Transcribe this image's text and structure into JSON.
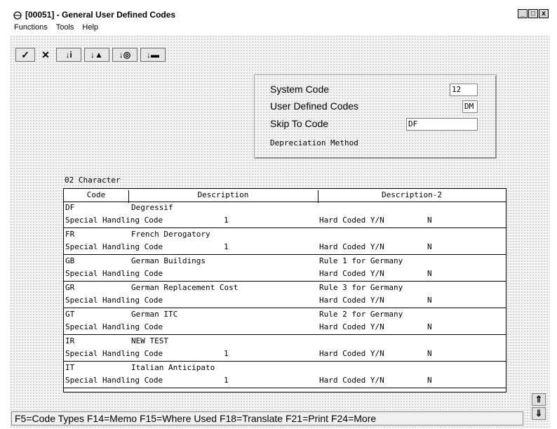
{
  "window": {
    "title": "[00051] - General User Defined Codes",
    "minimize": "_",
    "restore": "□",
    "close": "x",
    "icon": "app-icon"
  },
  "menu": {
    "functions": "Functions",
    "tools": "Tools",
    "help": "Help"
  },
  "toolbar": {
    "ok": "✓",
    "cancel": "✕",
    "find": "↓i",
    "add": "↓▲",
    "copy": "↓◎",
    "delete": "↓▬"
  },
  "header": {
    "system_code_label": "System Code",
    "system_code_value": "12",
    "udc_label": "User Defined Codes",
    "udc_value": "DM",
    "skip_label": "Skip To Code",
    "skip_value": "DF",
    "description": "Depreciation Method"
  },
  "grid": {
    "title": "02 Character",
    "columns": [
      "Code",
      "Description",
      "Description-2"
    ],
    "rows": [
      {
        "code": "DF",
        "desc": "Degressif",
        "desc2": "",
        "special": "Special Handling Code",
        "special_val": "1",
        "hard": "Hard Coded Y/N",
        "hard_val": "N"
      },
      {
        "code": "FR",
        "desc": "French Derogatory",
        "desc2": "",
        "special": "Special Handling Code",
        "special_val": "1",
        "hard": "Hard Coded Y/N",
        "hard_val": "N"
      },
      {
        "code": "GB",
        "desc": "German Buildings",
        "desc2": "Rule 1 for Germany",
        "special": "Special Handling Code",
        "special_val": "",
        "hard": "Hard Coded Y/N",
        "hard_val": "N"
      },
      {
        "code": "GR",
        "desc": "German Replacement Cost",
        "desc2": "Rule 3 for Germany",
        "special": "Special Handling Code",
        "special_val": "",
        "hard": "Hard Coded Y/N",
        "hard_val": "N"
      },
      {
        "code": "GT",
        "desc": "German ITC",
        "desc2": "Rule 2 for Germany",
        "special": "Special Handling Code",
        "special_val": "",
        "hard": "Hard Coded Y/N",
        "hard_val": "N"
      },
      {
        "code": "IR",
        "desc": "NEW TEST",
        "desc2": "",
        "special": "Special Handling Code",
        "special_val": "1",
        "hard": "Hard Coded Y/N",
        "hard_val": "N"
      },
      {
        "code": "IT",
        "desc": "Italian Anticipato",
        "desc2": "",
        "special": "Special Handling Code",
        "special_val": "1",
        "hard": "Hard Coded Y/N",
        "hard_val": "N"
      }
    ]
  },
  "status": {
    "text": "F5=Code Types F14=Memo F15=Where Used F18=Translate F21=Print F24=More"
  },
  "scroll": {
    "up": "⇑",
    "down": "⇓"
  }
}
